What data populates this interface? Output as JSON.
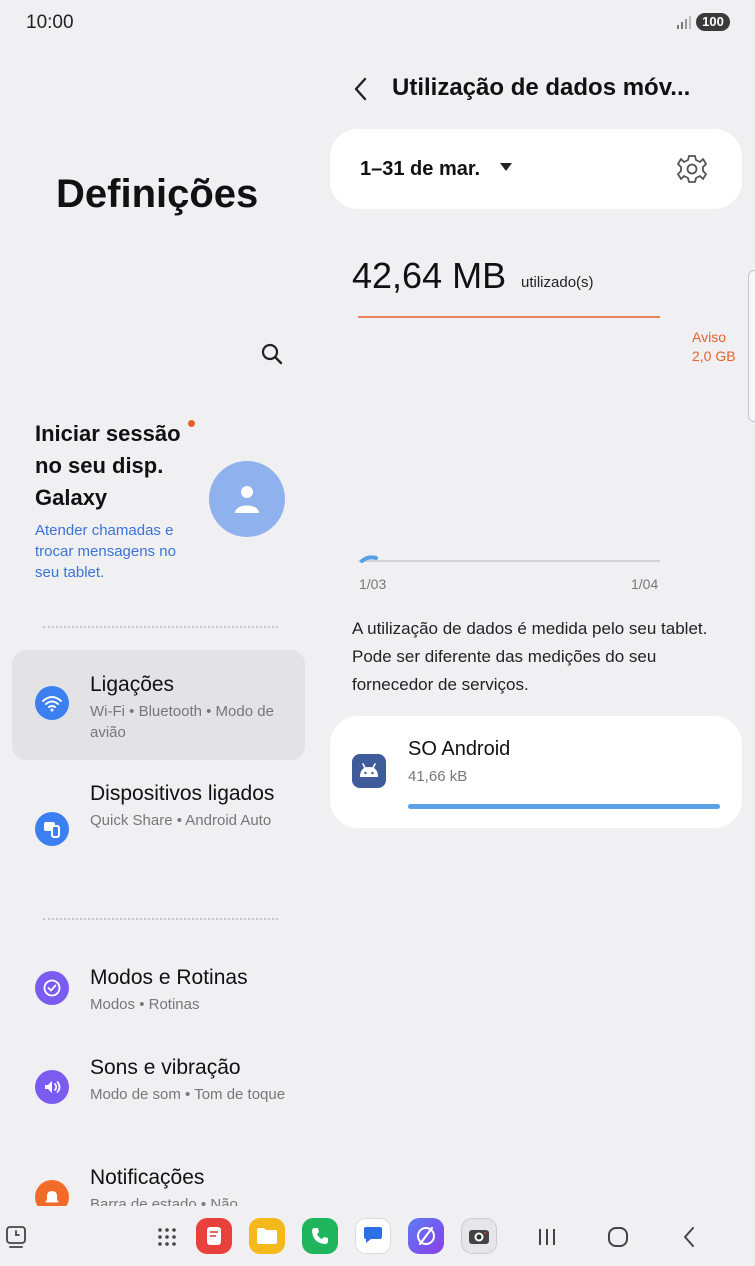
{
  "status_bar": {
    "time": "10:00",
    "battery": "100"
  },
  "left_panel": {
    "title": "Definições",
    "account": {
      "title": "Iniciar sessão no seu disp. Galaxy",
      "subtitle": "Atender chamadas e trocar mensagens no seu tablet."
    },
    "menu": [
      {
        "title": "Ligações",
        "subtitle": "Wi-Fi  •  Bluetooth  •  Modo de avião",
        "icon": "wifi-icon",
        "color": "#3b7ff0",
        "selected": true
      },
      {
        "title": "Dispositivos ligados",
        "subtitle": "Quick Share  •  Android Auto",
        "icon": "devices-icon",
        "color": "#3b7ff0",
        "selected": false
      },
      {
        "title": "Modos e Rotinas",
        "subtitle": "Modos  •  Rotinas",
        "icon": "check-circle-icon",
        "color": "#7a5cf0",
        "selected": false
      },
      {
        "title": "Sons e vibração",
        "subtitle": "Modo de som  •  Tom de toque",
        "icon": "speaker-icon",
        "color": "#7a5cf0",
        "selected": false
      },
      {
        "title": "Notificações",
        "subtitle": "Barra de estado  •  Não",
        "icon": "bell-icon",
        "color": "#f26b2b",
        "selected": false
      }
    ]
  },
  "right_panel": {
    "title": "Utilização de dados móv...",
    "period": "1–31 de mar.",
    "usage": {
      "amount": "42,64 MB",
      "unit": "utilizado(s)"
    },
    "chart": {
      "warning_label": "Aviso",
      "warning_value": "2,0 GB",
      "x_start": "1/03",
      "x_end": "1/04"
    },
    "info": "A utilização de dados é medida pelo seu tablet. Pode ser diferente das medições do seu fornecedor de serviços.",
    "apps": [
      {
        "name": "SO Android",
        "size": "41,66 kB",
        "share": 1.0
      }
    ]
  },
  "colors": {
    "accent": "#3b73d6",
    "warning": "#e5612b",
    "usage_bar": "#5aa0e6"
  },
  "dock": [
    "recents-app-icon",
    "app-drawer-icon",
    "notes-app-icon",
    "files-app-icon",
    "phone-app-icon",
    "messages-app-icon",
    "browser-app-icon",
    "camera-app-icon"
  ]
}
